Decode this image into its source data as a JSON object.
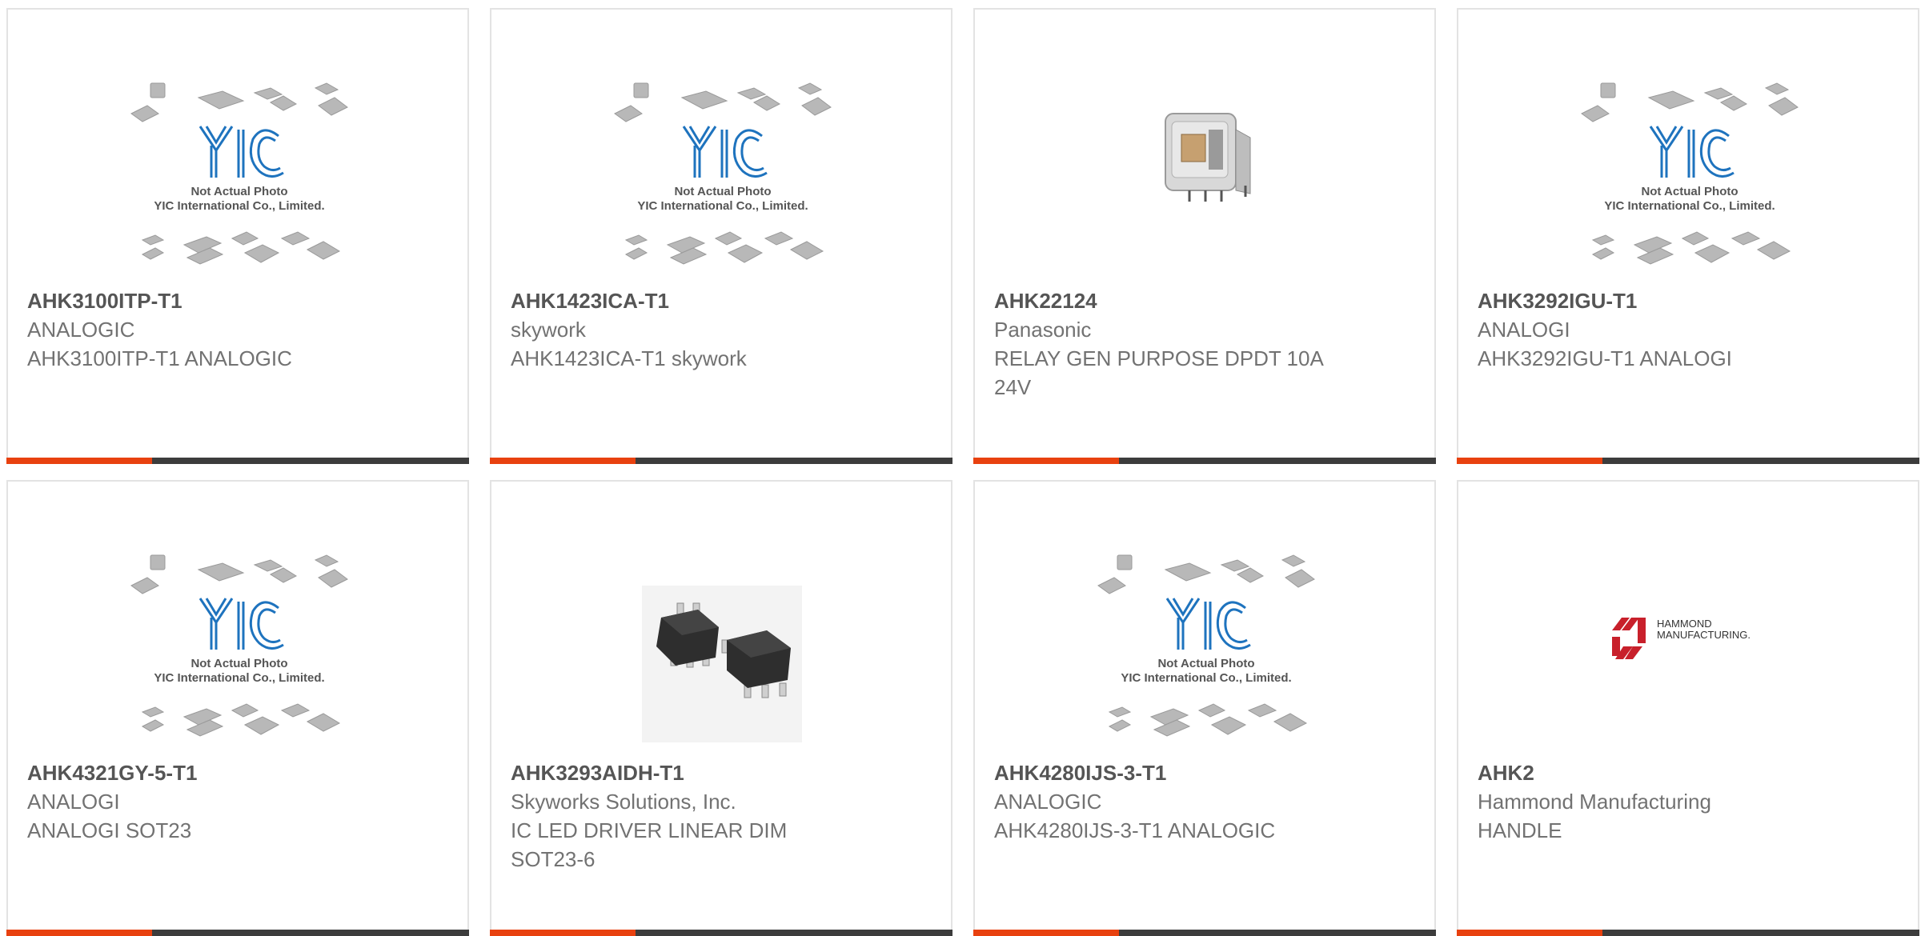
{
  "colors": {
    "accent": "#e8410f",
    "bar": "#3c3c3c",
    "border": "#e3e3e3",
    "text": "#6a6a6a"
  },
  "placeholder": {
    "logo": "YIC",
    "line1": "Not Actual Photo",
    "line2": "YIC International Co., Limited."
  },
  "products": [
    {
      "pn": "AHK3100ITP-T1",
      "mfr": "ANALOGIC",
      "desc": "AHK3100ITP-T1 ANALOGIC",
      "image": "placeholder"
    },
    {
      "pn": "AHK1423ICA-T1",
      "mfr": "skywork",
      "desc": "AHK1423ICA-T1 skywork",
      "image": "placeholder"
    },
    {
      "pn": "AHK22124",
      "mfr": "Panasonic",
      "desc": "RELAY GEN PURPOSE DPDT 10A 24V",
      "image": "relay"
    },
    {
      "pn": "AHK3292IGU-T1",
      "mfr": "ANALOGI",
      "desc": "AHK3292IGU-T1 ANALOGI",
      "image": "placeholder"
    },
    {
      "pn": "AHK4321GY-5-T1",
      "mfr": "ANALOGI",
      "desc": "ANALOGI SOT23",
      "image": "placeholder"
    },
    {
      "pn": "AHK3293AIDH-T1",
      "mfr": "Skyworks Solutions, Inc.",
      "desc": "IC LED DRIVER LINEAR DIM SOT23-6",
      "image": "sot23"
    },
    {
      "pn": "AHK4280IJS-3-T1",
      "mfr": "ANALOGIC",
      "desc": "AHK4280IJS-3-T1 ANALOGIC",
      "image": "placeholder"
    },
    {
      "pn": "AHK2",
      "mfr": "Hammond Manufacturing",
      "desc": "HANDLE",
      "image": "hammond"
    }
  ],
  "hammond_logo": {
    "line1": "HAMMOND",
    "line2": "MANUFACTURING."
  }
}
